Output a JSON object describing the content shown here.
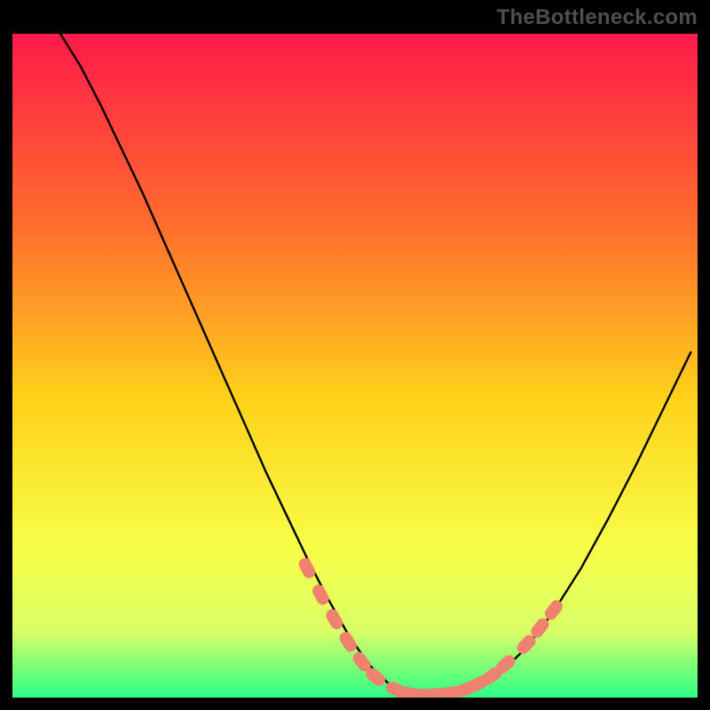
{
  "watermark": "TheBottleneck.com",
  "colors": {
    "frame_bg": "#000000",
    "gradient_top": "#ff1a4a",
    "gradient_mid1": "#ff6a2e",
    "gradient_mid2": "#ffd21a",
    "gradient_mid3": "#f7ff4a",
    "gradient_low": "#d9ff66",
    "gradient_bottom": "#2cff87",
    "curve": "#000000",
    "marker_fill": "#ef826f",
    "marker_stroke": "#ef826f"
  },
  "chart_data": {
    "type": "line",
    "title": "",
    "xlabel": "",
    "ylabel": "",
    "xlim": [
      0,
      100
    ],
    "ylim": [
      0,
      100
    ],
    "grid": false,
    "legend": false,
    "series": [
      {
        "name": "bottleneck-curve",
        "x": [
          7,
          10,
          13,
          16,
          19,
          22,
          25,
          28,
          31,
          34,
          37,
          40,
          43,
          46,
          49,
          52,
          55,
          58,
          61,
          64,
          67,
          71,
          75,
          79,
          83,
          87,
          91,
          95,
          99
        ],
        "values": [
          100,
          95,
          89,
          82.5,
          76,
          69,
          62,
          55,
          48,
          41,
          34,
          27.5,
          21,
          15,
          9.5,
          5,
          2,
          0.7,
          0.4,
          0.6,
          1.4,
          3.5,
          7.5,
          13,
          19.5,
          27,
          35,
          43.5,
          52
        ]
      }
    ],
    "markers": {
      "name": "highlighted-points",
      "x": [
        43,
        45,
        47,
        49,
        51,
        53,
        56,
        58,
        60,
        62,
        64,
        66,
        68,
        70,
        72,
        75,
        77,
        79
      ],
      "values": [
        19.5,
        15.5,
        11.8,
        8.4,
        5.4,
        3.1,
        1.2,
        0.6,
        0.4,
        0.5,
        0.7,
        1.2,
        2.1,
        3.3,
        5.0,
        8.0,
        10.5,
        13.2
      ]
    }
  }
}
